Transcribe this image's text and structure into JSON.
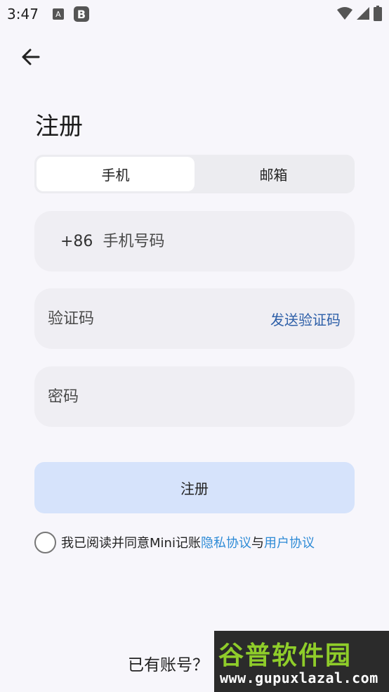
{
  "status_bar": {
    "time": "3:47",
    "notif_a": "A",
    "notif_b": "B",
    "icons": [
      "wifi-icon",
      "cellular-signal-icon",
      "battery-icon"
    ]
  },
  "header": {
    "back_icon": "arrow-left-icon"
  },
  "page": {
    "title": "注册"
  },
  "tabs": [
    {
      "label": "手机",
      "active": true
    },
    {
      "label": "邮箱",
      "active": false
    }
  ],
  "form": {
    "phone": {
      "country_code": "+86",
      "placeholder": "手机号码",
      "value": ""
    },
    "code": {
      "placeholder": "验证码",
      "value": "",
      "send_label": "发送验证码"
    },
    "password": {
      "placeholder": "密码",
      "value": ""
    }
  },
  "register_button": "注册",
  "agreement": {
    "checked": false,
    "prefix": "我已阅读并同意Mini记账",
    "privacy_link": "隐私协议",
    "connector": "与",
    "terms_link": "用户协议"
  },
  "footer": {
    "have_account": "已有账号？"
  },
  "watermark": {
    "title": "谷普软件园",
    "url": "www.gupuxlazal.com"
  },
  "colors": {
    "background": "#f7f6fb",
    "accent_link": "#2e8bd6",
    "send_code": "#2d5fa8",
    "button_bg": "#d6e3fb",
    "field_bg": "#efeef3"
  }
}
